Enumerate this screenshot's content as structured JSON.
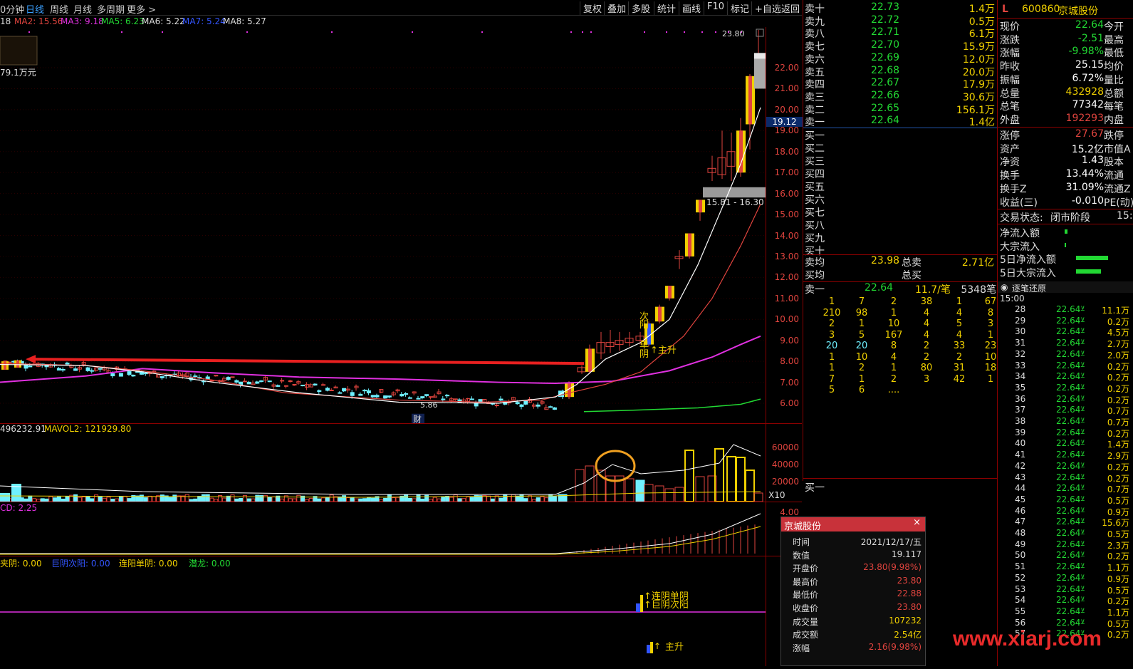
{
  "toolbar": {
    "period_tabs": [
      "0分钟",
      "日线",
      "周线",
      "月线",
      "多周期",
      "更多 >"
    ],
    "buttons": [
      "复权",
      "叠加",
      "多股",
      "统计",
      "画线",
      "F10",
      "标记",
      "+自选",
      "返回"
    ]
  },
  "ma_legend": [
    {
      "text": "18",
      "color": "#dddddd"
    },
    {
      "text": "MA2: 15.56",
      "color": "#e0443e"
    },
    {
      "text": "MA3: 9.18",
      "color": "#e030e0"
    },
    {
      "text": "MA5: 6.23",
      "color": "#22d833"
    },
    {
      "text": "MA6: 5.22",
      "color": "#dddddd"
    },
    {
      "text": "MA7: 5.24",
      "color": "#3355ff"
    },
    {
      "text": "MA8: 5.27",
      "color": "#dddddd"
    }
  ],
  "chart_labels": {
    "amount": "79.1万元",
    "high_label": "23.80",
    "low_label": "5.86",
    "cai": "财",
    "range_label": "15.81 - 16.30",
    "partial_label": "21.",
    "current_price_tag": "19.12",
    "annot_ci": "次",
    "annot_yang": "阳",
    "annot_single": "单",
    "annot_yin": "阴",
    "annot_main_up": "↑主升",
    "annot_lianyin": "↑连阴单阴",
    "annot_juyin": "↑巨阴次阳",
    "annot_main_up2": "主升"
  },
  "y_axis_ticks": [
    "22.00",
    "21.00",
    "20.00",
    "19.00",
    "18.00",
    "17.00",
    "16.00",
    "15.00",
    "14.00",
    "13.00",
    "12.00",
    "11.00",
    "10.00",
    "9.00",
    "8.00",
    "7.00",
    "6.00"
  ],
  "vol_legend": [
    {
      "text": "496232.91",
      "color": "#dddddd"
    },
    {
      "text": "MAVOL2: 121929.80",
      "color": "#f0d000"
    }
  ],
  "vol_axis_ticks": [
    "60000",
    "40000",
    "20000",
    "X10"
  ],
  "macd_legend": {
    "text": "CD: 2.25",
    "color": "#e030e0"
  },
  "macd_axis_ticks": [
    "4.00"
  ],
  "sig_legend": [
    {
      "text": "夹阴: 0.00",
      "color": "#f0d000"
    },
    {
      "text": "巨阴次阳: 0.00",
      "color": "#3355ff"
    },
    {
      "text": "连阳单阴: 0.00",
      "color": "#f0d000"
    },
    {
      "text": "潜龙: 0.00",
      "color": "#22d833"
    }
  ],
  "order_book": {
    "asks": [
      {
        "label": "卖十",
        "price": "22.73",
        "vol": "1.4万"
      },
      {
        "label": "卖九",
        "price": "22.72",
        "vol": "0.5万"
      },
      {
        "label": "卖八",
        "price": "22.71",
        "vol": "6.1万"
      },
      {
        "label": "卖七",
        "price": "22.70",
        "vol": "15.9万"
      },
      {
        "label": "卖六",
        "price": "22.69",
        "vol": "12.0万"
      },
      {
        "label": "卖五",
        "price": "22.68",
        "vol": "20.0万"
      },
      {
        "label": "卖四",
        "price": "22.67",
        "vol": "17.9万"
      },
      {
        "label": "卖三",
        "price": "22.66",
        "vol": "30.6万"
      },
      {
        "label": "卖二",
        "price": "22.65",
        "vol": "156.1万"
      },
      {
        "label": "卖一",
        "price": "22.64",
        "vol": "1.4亿"
      }
    ],
    "bids": [
      "买一",
      "买二",
      "买三",
      "买四",
      "买五",
      "买六",
      "买七",
      "买八",
      "买九",
      "买十"
    ],
    "avg_sell_label": "卖均",
    "avg_sell_price": "23.98",
    "total_sell_label": "总卖",
    "total_sell_value": "2.71亿",
    "avg_buy_label": "买均",
    "total_buy_label": "总买"
  },
  "queue": {
    "header_label": "卖一",
    "header_price": "22.64",
    "header_vol": "11.7/笔",
    "header_count": "5348笔",
    "rows": [
      [
        "1",
        "7",
        "2",
        "38",
        "1",
        "67"
      ],
      [
        "210",
        "98",
        "1",
        "4",
        "4",
        "8"
      ],
      [
        "2",
        "1",
        "10",
        "4",
        "5",
        "3"
      ],
      [
        "3",
        "5",
        "167",
        "4",
        "4",
        "1"
      ],
      [
        "20",
        "20",
        "8",
        "2",
        "33",
        "23"
      ],
      [
        "1",
        "10",
        "4",
        "2",
        "2",
        "10"
      ],
      [
        "1",
        "2",
        "1",
        "80",
        "31",
        "18"
      ],
      [
        "7",
        "1",
        "2",
        "3",
        "42",
        "1"
      ],
      [
        "5",
        "6",
        "....",
        "",
        "",
        ""
      ]
    ],
    "footer_label": "买一"
  },
  "quote": {
    "flag": "L",
    "code": "600860",
    "name": "京城股份",
    "rows": [
      {
        "k": "现价",
        "v": "22.64",
        "c": "#22d833",
        "k2": "今开"
      },
      {
        "k": "涨跌",
        "v": "-2.51",
        "c": "#22d833",
        "k2": "最高"
      },
      {
        "k": "涨幅",
        "v": "-9.98%",
        "c": "#22d833",
        "k2": "最低"
      },
      {
        "k": "昨收",
        "v": "25.15",
        "c": "#ffffff",
        "k2": "均价"
      },
      {
        "k": "振幅",
        "v": "6.72%",
        "c": "#ffffff",
        "k2": "量比"
      },
      {
        "k": "总量",
        "v": "432928",
        "c": "#f0d000",
        "k2": "总额"
      },
      {
        "k": "总笔",
        "v": "77342",
        "c": "#ffffff",
        "k2": "每笔"
      },
      {
        "k": "外盘",
        "v": "192293",
        "c": "#e0443e",
        "k2": "内盘"
      },
      {
        "k": "涨停",
        "v": "27.67",
        "c": "#e0443e",
        "k2": "跌停"
      },
      {
        "k": "资产",
        "v": "15.2亿",
        "c": "#ffffff",
        "k2": "市值A"
      },
      {
        "k": "净资",
        "v": "1.43",
        "c": "#ffffff",
        "k2": "股本"
      },
      {
        "k": "换手",
        "v": "13.44%",
        "c": "#ffffff",
        "k2": "流通"
      },
      {
        "k": "换手Z",
        "v": "31.09%",
        "c": "#ffffff",
        "k2": "流通Z"
      },
      {
        "k": "收益(三)",
        "v": "-0.010",
        "c": "#ffffff",
        "k2": "PE(动)"
      }
    ],
    "trade_status_label": "交易状态:",
    "trade_status": "闭市阶段",
    "trade_time": "15:0",
    "flows": [
      {
        "k": "净流入额",
        "bar": 0.07
      },
      {
        "k": "大宗流入",
        "bar": 0.03
      },
      {
        "k": "5日净流入额",
        "bar": 0.9
      },
      {
        "k": "5日大宗流入",
        "bar": 0.7
      }
    ]
  },
  "ticks": {
    "header": "逐笔还原",
    "first_time": "15:00",
    "rows": [
      {
        "t": "28",
        "p": "22.64",
        "v": "11.1万"
      },
      {
        "t": "29",
        "p": "22.64",
        "v": "0.2万"
      },
      {
        "t": "30",
        "p": "22.64",
        "v": "4.5万"
      },
      {
        "t": "31",
        "p": "22.64",
        "v": "2.7万"
      },
      {
        "t": "32",
        "p": "22.64",
        "v": "2.0万"
      },
      {
        "t": "33",
        "p": "22.64",
        "v": "0.2万"
      },
      {
        "t": "34",
        "p": "22.64",
        "v": "0.2万"
      },
      {
        "t": "35",
        "p": "22.64",
        "v": "0.2万"
      },
      {
        "t": "36",
        "p": "22.64",
        "v": "0.2万"
      },
      {
        "t": "37",
        "p": "22.64",
        "v": "0.7万"
      },
      {
        "t": "38",
        "p": "22.64",
        "v": "0.7万"
      },
      {
        "t": "39",
        "p": "22.64",
        "v": "0.2万"
      },
      {
        "t": "40",
        "p": "22.64",
        "v": "1.4万"
      },
      {
        "t": "41",
        "p": "22.64",
        "v": "2.9万"
      },
      {
        "t": "42",
        "p": "22.64",
        "v": "0.2万"
      },
      {
        "t": "43",
        "p": "22.64",
        "v": "0.2万"
      },
      {
        "t": "44",
        "p": "22.64",
        "v": "0.7万"
      },
      {
        "t": "45",
        "p": "22.64",
        "v": "0.5万"
      },
      {
        "t": "46",
        "p": "22.64",
        "v": "0.9万"
      },
      {
        "t": "47",
        "p": "22.64",
        "v": "15.6万"
      },
      {
        "t": "48",
        "p": "22.64",
        "v": "0.5万"
      },
      {
        "t": "49",
        "p": "22.64",
        "v": "2.3万"
      },
      {
        "t": "50",
        "p": "22.64",
        "v": "0.2万"
      },
      {
        "t": "51",
        "p": "22.64",
        "v": "1.1万"
      },
      {
        "t": "52",
        "p": "22.64",
        "v": "0.9万"
      },
      {
        "t": "53",
        "p": "22.64",
        "v": "0.5万"
      },
      {
        "t": "54",
        "p": "22.64",
        "v": "0.2万"
      },
      {
        "t": "55",
        "p": "22.64",
        "v": "1.1万"
      },
      {
        "t": "56",
        "p": "22.64",
        "v": "0.5万"
      },
      {
        "t": "57",
        "p": "22.64",
        "v": "0.2万"
      }
    ]
  },
  "popup": {
    "title": "京城股份",
    "close": "×",
    "rows": [
      {
        "k": "时间",
        "v": "2021/12/17/五",
        "c": "#dddddd"
      },
      {
        "k": "数值",
        "v": "19.117",
        "c": "#dddddd"
      },
      {
        "k": "开盘价",
        "v": "23.80(9.98%)",
        "c": "#e0443e"
      },
      {
        "k": "最高价",
        "v": "23.80",
        "c": "#e0443e"
      },
      {
        "k": "最低价",
        "v": "22.88",
        "c": "#e0443e"
      },
      {
        "k": "收盘价",
        "v": "23.80",
        "c": "#e0443e"
      },
      {
        "k": "成交量",
        "v": "107232",
        "c": "#f0d000"
      },
      {
        "k": "成交额",
        "v": "2.54亿",
        "c": "#f0d000"
      },
      {
        "k": "涨幅",
        "v": "2.16(9.98%)",
        "c": "#e0443e"
      }
    ]
  },
  "watermark": "www.xiarj.com"
}
